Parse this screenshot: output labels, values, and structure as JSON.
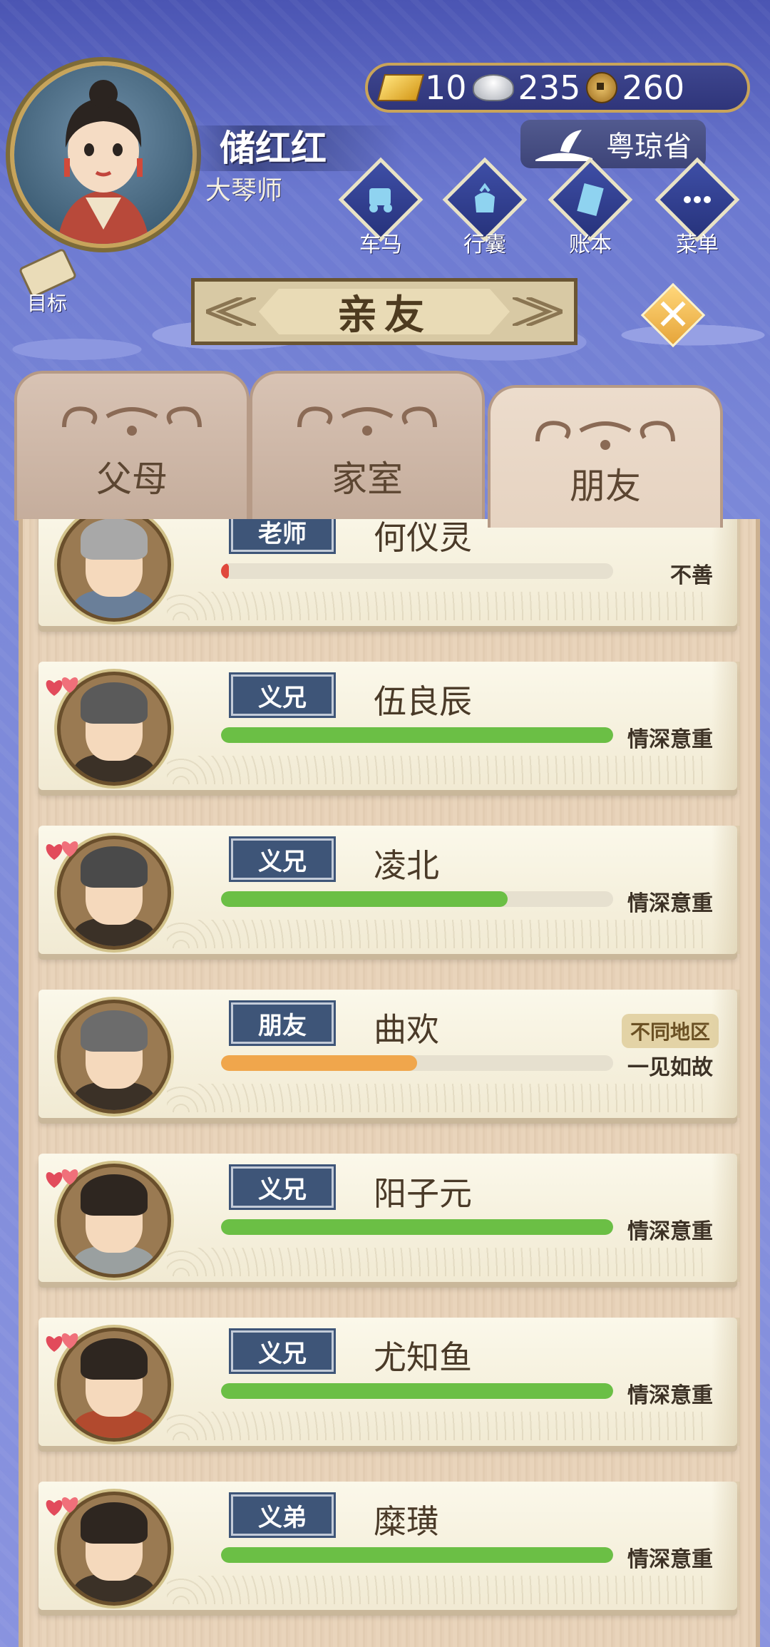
{
  "player": {
    "name": "储红红",
    "title": "大琴师"
  },
  "currency": {
    "gold": "10",
    "silver": "235",
    "copper": "260"
  },
  "province": "粤琼省",
  "menu": [
    {
      "label": "车马",
      "icon": "carriage-icon"
    },
    {
      "label": "行囊",
      "icon": "bag-icon"
    },
    {
      "label": "账本",
      "icon": "ledger-icon"
    },
    {
      "label": "菜单",
      "icon": "menu-dots-icon"
    }
  ],
  "goal_label": "目标",
  "banner_title": "亲友",
  "tabs": [
    {
      "label": "父母",
      "active": false
    },
    {
      "label": "家室",
      "active": false
    },
    {
      "label": "朋友",
      "active": true
    }
  ],
  "friends": [
    {
      "relation": "老师",
      "name": "何仪灵",
      "level": "不善",
      "progress": 0.02,
      "bar_color": "#e0483c",
      "hearts": false,
      "region": ""
    },
    {
      "relation": "义兄",
      "name": "伍良辰",
      "level": "情深意重",
      "progress": 1.0,
      "bar_color": "#6bbf45",
      "hearts": true,
      "region": ""
    },
    {
      "relation": "义兄",
      "name": "凌北",
      "level": "情深意重",
      "progress": 0.73,
      "bar_color": "#6bbf45",
      "hearts": true,
      "region": ""
    },
    {
      "relation": "朋友",
      "name": "曲欢",
      "level": "一见如故",
      "progress": 0.5,
      "bar_color": "#f0a64c",
      "hearts": false,
      "region": "不同地区"
    },
    {
      "relation": "义兄",
      "name": "阳子元",
      "level": "情深意重",
      "progress": 1.0,
      "bar_color": "#6bbf45",
      "hearts": true,
      "region": ""
    },
    {
      "relation": "义兄",
      "name": "尤知鱼",
      "level": "情深意重",
      "progress": 1.0,
      "bar_color": "#6bbf45",
      "hearts": true,
      "region": ""
    },
    {
      "relation": "义弟",
      "name": "糜璜",
      "level": "情深意重",
      "progress": 1.0,
      "bar_color": "#6bbf45",
      "hearts": true,
      "region": ""
    }
  ]
}
